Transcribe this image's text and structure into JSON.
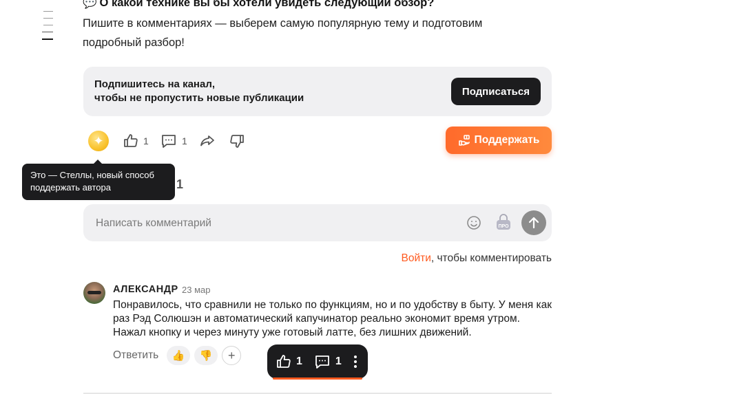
{
  "article": {
    "heading_emoji": "💬",
    "heading": "О какой технике вы бы хотели увидеть следующий обзор?",
    "text": "Пишите в комментариях — выберем самую популярную тему и подготовим подробный разбор!"
  },
  "subscribe": {
    "line1": "Подпишитесь на канал,",
    "line2": "чтобы не пропустить новые публикации",
    "button": "Подписаться"
  },
  "actions": {
    "likes": "1",
    "comments": "1",
    "support_label": "Поддержать"
  },
  "tooltip": {
    "line1": "Это — Стеллы, новый способ",
    "line2": "поддержать автора"
  },
  "comments_section": {
    "count": "1",
    "input_placeholder": "Написать комментарий",
    "pro_label": "ПРО",
    "login_link": "Войти",
    "login_suffix": ", чтобы комментировать"
  },
  "comment": {
    "author": "АЛЕКСАНДР",
    "date": "23 мар",
    "text": "Понравилось, что сравнили не только по функциям, но и по удобству в быту. У меня как раз Рэд Солюшэн и автоматический капучинатор реально экономит время утром. Нажал кнопку и через минуту уже готовый латте, без лишних движений.",
    "reply_label": "Ответить",
    "reactions": [
      "👍",
      "👎"
    ],
    "add_reaction": "+"
  },
  "floating_bar": {
    "likes": "1",
    "comments": "1"
  },
  "colors": {
    "accent": "#ff5a1f",
    "dark": "#1c1c1e",
    "card_bg": "#f0f0f2"
  }
}
